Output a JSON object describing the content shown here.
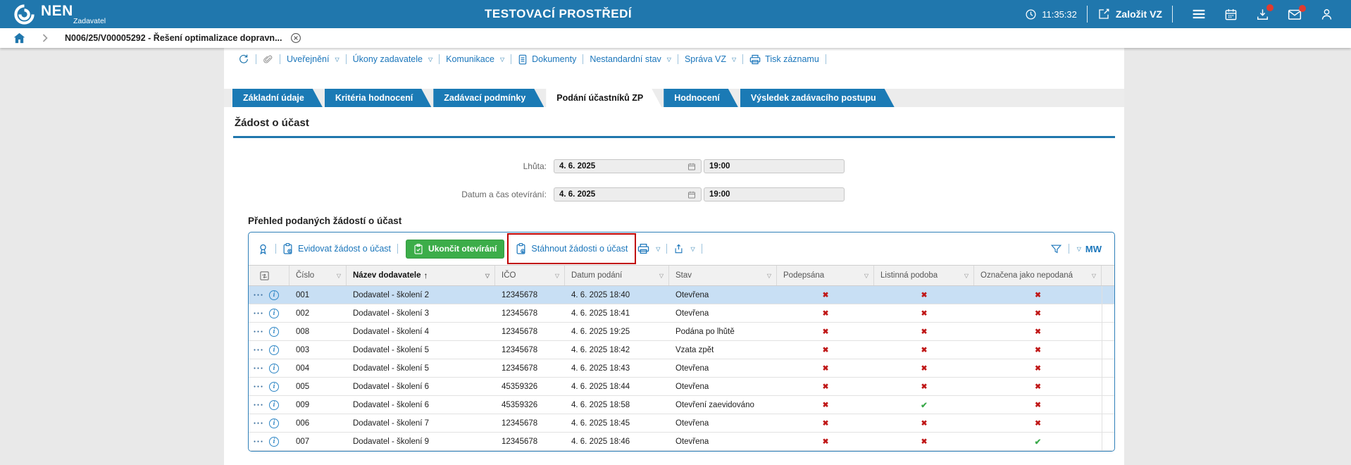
{
  "header": {
    "logo_title": "NEN",
    "logo_subtitle": "Zadavatel",
    "env_title": "TESTOVACÍ PROSTŘEDÍ",
    "time": "11:35:32",
    "create_vz_label": "Založit VZ"
  },
  "breadcrumb": {
    "item": "N006/25/V00005292 - Řešení optimalizace dopravn..."
  },
  "cmdbar": {
    "items": [
      {
        "label": "Uveřejnění",
        "dropdown": true
      },
      {
        "label": "Úkony zadavatele",
        "dropdown": true
      },
      {
        "label": "Komunikace",
        "dropdown": true
      },
      {
        "label": "Dokumenty",
        "dropdown": false
      },
      {
        "label": "Nestandardní stav",
        "dropdown": true
      },
      {
        "label": "Správa VZ",
        "dropdown": true
      },
      {
        "label": "Tisk záznamu",
        "dropdown": false
      }
    ]
  },
  "tabs": [
    {
      "label": "Základní údaje",
      "active": false
    },
    {
      "label": "Kritéria hodnocení",
      "active": false
    },
    {
      "label": "Zadávací podmínky",
      "active": false
    },
    {
      "label": "Podání účastníků ZP",
      "active": true
    },
    {
      "label": "Hodnocení",
      "active": false
    },
    {
      "label": "Výsledek zadávacího postupu",
      "active": false
    }
  ],
  "section": {
    "title": "Žádost o účast"
  },
  "form": {
    "fields": [
      {
        "label": "Lhůta:",
        "date": "4. 6. 2025",
        "time": "19:00"
      },
      {
        "label": "Datum a čas otevírání:",
        "date": "4. 6. 2025",
        "time": "19:00"
      }
    ]
  },
  "table": {
    "title": "Přehled podaných žádostí o účast",
    "toolbar": {
      "evidovat": "Evidovat žádost o účast",
      "ukoncit": "Ukončit otevírání",
      "stahnout": "Stáhnout žádosti o účast",
      "mw": "MW"
    },
    "columns": [
      "Číslo",
      "Název dodavatele",
      "IČO",
      "Datum podání",
      "Stav",
      "Podepsána",
      "Listinná podoba",
      "Označena jako nepodaná"
    ],
    "sort": {
      "column": "Název dodavatele",
      "direction": "asc"
    },
    "rows": [
      {
        "num": "001",
        "name": "Dodavatel - školení 2",
        "ico": "12345678",
        "date": "4. 6. 2025 18:40",
        "status": "Otevřena",
        "signed": "x",
        "paper": "x",
        "notfiled": "x"
      },
      {
        "num": "002",
        "name": "Dodavatel - školení 3",
        "ico": "12345678",
        "date": "4. 6. 2025 18:41",
        "status": "Otevřena",
        "signed": "x",
        "paper": "x",
        "notfiled": "x"
      },
      {
        "num": "008",
        "name": "Dodavatel - školení 4",
        "ico": "12345678",
        "date": "4. 6. 2025 19:25",
        "status": "Podána po lhůtě",
        "signed": "x",
        "paper": "x",
        "notfiled": "x"
      },
      {
        "num": "003",
        "name": "Dodavatel - školení 5",
        "ico": "12345678",
        "date": "4. 6. 2025 18:42",
        "status": "Vzata zpět",
        "signed": "x",
        "paper": "x",
        "notfiled": "x"
      },
      {
        "num": "004",
        "name": "Dodavatel - školení 5",
        "ico": "12345678",
        "date": "4. 6. 2025 18:43",
        "status": "Otevřena",
        "signed": "x",
        "paper": "x",
        "notfiled": "x"
      },
      {
        "num": "005",
        "name": "Dodavatel - školení 6",
        "ico": "45359326",
        "date": "4. 6. 2025 18:44",
        "status": "Otevřena",
        "signed": "x",
        "paper": "x",
        "notfiled": "x"
      },
      {
        "num": "009",
        "name": "Dodavatel - školení 6",
        "ico": "45359326",
        "date": "4. 6. 2025 18:58",
        "status": "Otevření zaevidováno",
        "signed": "x",
        "paper": "check",
        "notfiled": "x"
      },
      {
        "num": "006",
        "name": "Dodavatel - školení 7",
        "ico": "12345678",
        "date": "4. 6. 2025 18:45",
        "status": "Otevřena",
        "signed": "x",
        "paper": "x",
        "notfiled": "x"
      },
      {
        "num": "007",
        "name": "Dodavatel - školení 9",
        "ico": "12345678",
        "date": "4. 6. 2025 18:46",
        "status": "Otevřena",
        "signed": "x",
        "paper": "x",
        "notfiled": "check"
      }
    ]
  },
  "colors": {
    "header_bg": "#2077ad",
    "tab_bg": "#1b7ab5",
    "link_blue": "#1b76bb",
    "green_button": "#3cad49",
    "annotation_red": "#c00000",
    "mark_red": "#c01818",
    "mark_green": "#3aa94a",
    "row_highlight": "#c8dff4"
  }
}
